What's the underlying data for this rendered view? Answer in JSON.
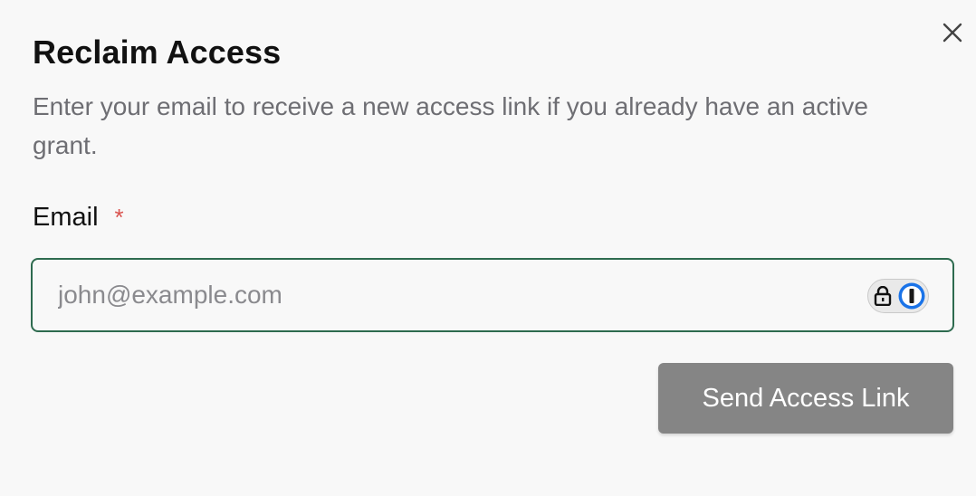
{
  "dialog": {
    "title": "Reclaim Access",
    "description": "Enter your email to receive a new access link if you already have an active grant.",
    "close_icon": "close-icon"
  },
  "form": {
    "email_label": "Email",
    "required_marker": "*",
    "email_placeholder": "john@example.com",
    "email_value": "",
    "password_manager_icons": [
      "lock-icon",
      "onepassword-icon"
    ],
    "submit_label": "Send Access Link"
  },
  "colors": {
    "background": "#f8f8f8",
    "input_border": "#2e6b4f",
    "required": "#d9534f",
    "button_bg": "#858585",
    "button_text": "#ffffff",
    "password_manager_blue": "#1a73e8"
  }
}
